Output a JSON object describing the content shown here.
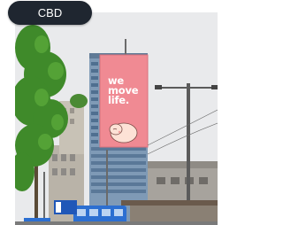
{
  "location_chip": {
    "label": "CBD"
  },
  "billboard": {
    "tagline_small": "",
    "line1": "we",
    "line2": "move",
    "line3": "life."
  },
  "street_sign": {
    "text": ""
  },
  "colors": {
    "chip_bg": "#1f2630",
    "sky": "#e9eaec",
    "billboard_pink": "#f08a93",
    "tree_green": "#3f8a2a",
    "building_blue": "#6f8fb0"
  }
}
